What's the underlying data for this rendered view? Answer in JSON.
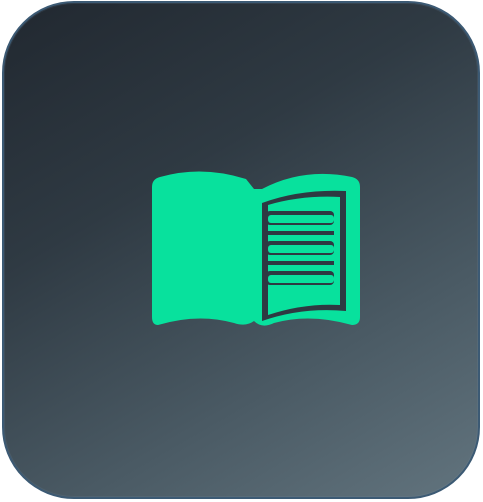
{
  "app_icon": {
    "icon": "open-book-icon",
    "colors": {
      "icon_fill": "#08e19d",
      "background_dark": "#212830",
      "background_light": "#62747e",
      "border": "#3c5a74"
    }
  }
}
